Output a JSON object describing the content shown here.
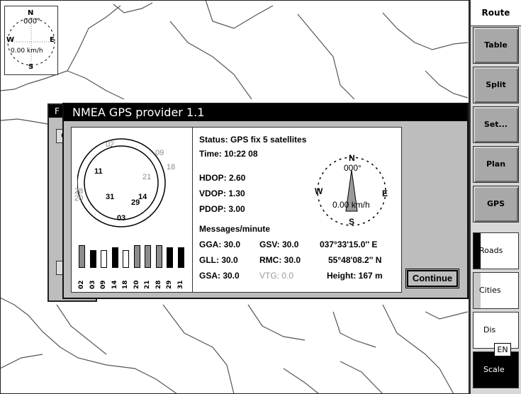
{
  "mini_compass": {
    "n": "N",
    "s": "S",
    "e": "E",
    "w": "W",
    "heading": "000°",
    "speed": "0.00 km/h"
  },
  "toolbar": {
    "title": "Route",
    "buttons": [
      "Table",
      "Split",
      "Set...",
      "Plan",
      "GPS"
    ],
    "layer_buttons": [
      "Roads",
      "Cities",
      "Dis",
      "Scale"
    ]
  },
  "background_dialog": {
    "title": "F",
    "tab": "C"
  },
  "dialog": {
    "title": "NMEA GPS provider 1.1",
    "status": "Status: GPS fix 5 satellites",
    "time": "Time: 10:22 08",
    "hdop": "HDOP: 2.60",
    "vdop": "VDOP: 1.30",
    "pdop": "PDOP: 3.00",
    "messages_header": "Messages/minute",
    "gga": "GGA: 30.0",
    "gsv": "GSV: 30.0",
    "gll": "GLL: 30.0",
    "rmc": "RMC: 30.0",
    "gsa": "GSA: 30.0",
    "vtg": "VTG: 0.0",
    "longitude": "037°33'15.0'' E",
    "latitude": "55°48'08.2'' N",
    "height": "Height: 167 m",
    "compass": {
      "n": "N",
      "s": "S",
      "e": "E",
      "w": "W",
      "heading": "000°",
      "speed": "0.00 km/h"
    },
    "continue_label": "Continue",
    "satellites": [
      {
        "id": "02",
        "active": false
      },
      {
        "id": "09",
        "active": false
      },
      {
        "id": "18",
        "active": false
      },
      {
        "id": "11",
        "active": true
      },
      {
        "id": "21",
        "active": false
      },
      {
        "id": "28",
        "active": false
      },
      {
        "id": "20",
        "active": false
      },
      {
        "id": "31",
        "active": true
      },
      {
        "id": "29",
        "active": true
      },
      {
        "id": "14",
        "active": true
      },
      {
        "id": "03",
        "active": true
      }
    ],
    "signal_bars": [
      {
        "id": "02",
        "level": 0.9,
        "fill": "gray"
      },
      {
        "id": "03",
        "level": 0.7,
        "fill": "black"
      },
      {
        "id": "09",
        "level": 0.7,
        "fill": "white"
      },
      {
        "id": "14",
        "level": 0.8,
        "fill": "black"
      },
      {
        "id": "18",
        "level": 0.7,
        "fill": "white"
      },
      {
        "id": "20",
        "level": 0.9,
        "fill": "gray"
      },
      {
        "id": "21",
        "level": 0.9,
        "fill": "gray"
      },
      {
        "id": "28",
        "level": 0.9,
        "fill": "gray"
      },
      {
        "id": "29",
        "level": 0.8,
        "fill": "black"
      },
      {
        "id": "31",
        "level": 0.8,
        "fill": "black"
      }
    ]
  },
  "language_indicator": "EN",
  "colors": {
    "titlebar": "#000000",
    "dialog_bg": "#bdbdbd",
    "button_bg": "#a8a8a8"
  }
}
